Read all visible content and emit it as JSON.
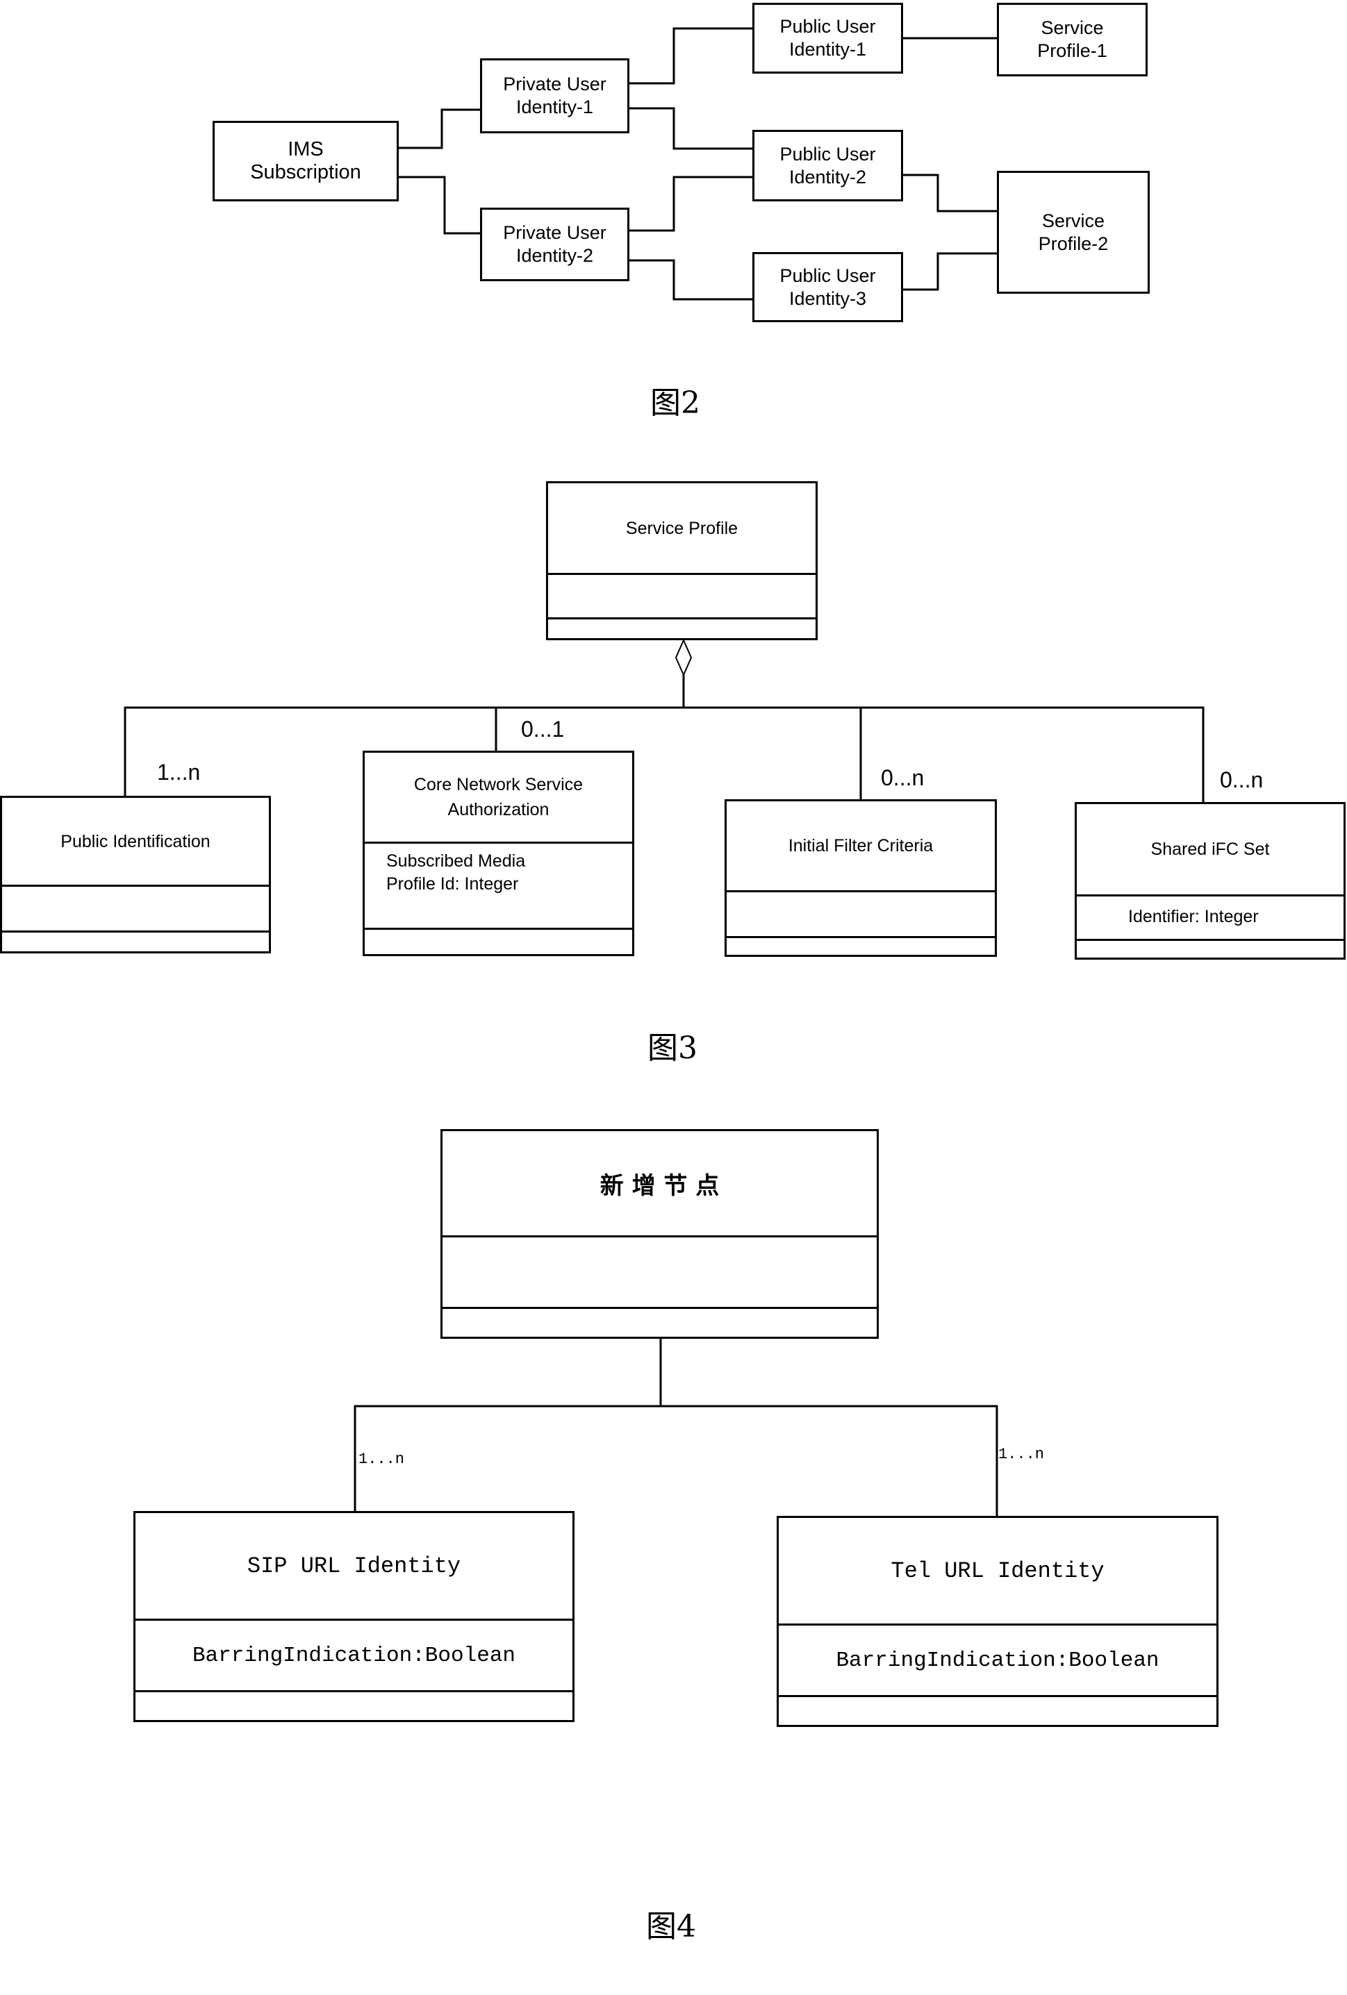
{
  "figure2": {
    "caption": "图2",
    "nodes": {
      "ims": [
        "IMS",
        "Subscription"
      ],
      "priv1": [
        "Private User",
        "Identity-1"
      ],
      "priv2": [
        "Private User",
        "Identity-2"
      ],
      "pub1": [
        "Public User",
        "Identity-1"
      ],
      "pub2": [
        "Public User",
        "Identity-2"
      ],
      "pub3": [
        "Public User",
        "Identity-3"
      ],
      "sp1": [
        "Service",
        "Profile-1"
      ],
      "sp2": [
        "Service",
        "Profile-2"
      ]
    }
  },
  "figure3": {
    "caption": "图3",
    "service_profile": "Service Profile",
    "public_identification": {
      "name": "Public Identification",
      "multiplicity": "1...n"
    },
    "cnsa": {
      "name": [
        "Core Network Service",
        "Authorization"
      ],
      "attributes": [
        "Subscribed Media",
        "Profile Id: Integer"
      ],
      "multiplicity": "0...1"
    },
    "ifc": {
      "name": "Initial Filter Criteria",
      "multiplicity": "0...n"
    },
    "shared_ifc": {
      "name": "Shared iFC Set",
      "attribute": "Identifier: Integer",
      "multiplicity": "0...n"
    }
  },
  "figure4": {
    "caption": "图4",
    "parent": "新 增 节 点",
    "sip": {
      "name": "SIP URL Identity",
      "attribute": "BarringIndication:Boolean",
      "multiplicity": "1...n"
    },
    "tel": {
      "name": "Tel URL Identity",
      "attribute": "BarringIndication:Boolean",
      "multiplicity": "1...n"
    }
  }
}
